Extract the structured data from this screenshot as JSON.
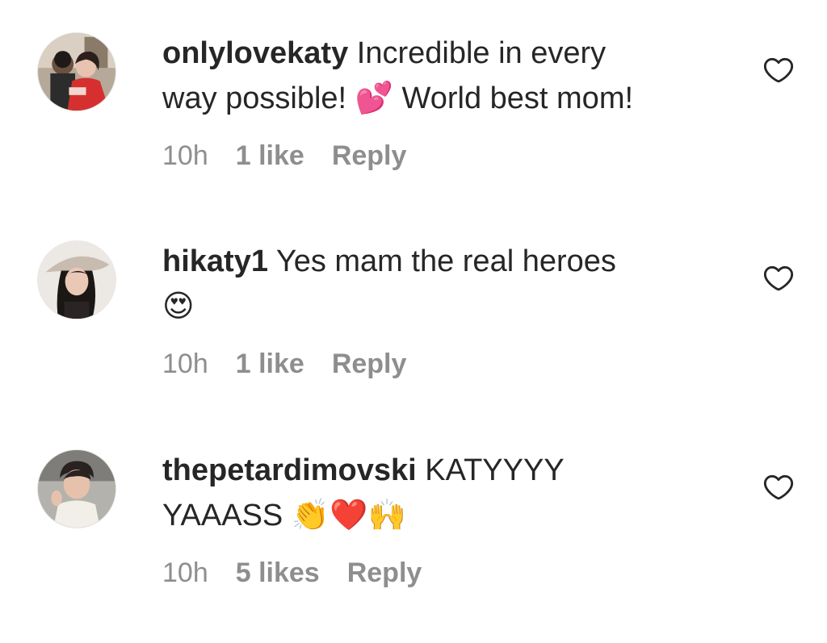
{
  "comments": [
    {
      "username": "onlylovekaty",
      "text": "Incredible in every\nway possible! 💕 World best mom!",
      "time": "10h",
      "likes": "1 like",
      "reply": "Reply",
      "avatar_icon": "user-avatar-photo",
      "like_icon": "heart-outline-icon"
    },
    {
      "username": "hikaty1",
      "text": "Yes mam the real heroes\n😍",
      "time": "10h",
      "likes": "1 like",
      "reply": "Reply",
      "avatar_icon": "user-avatar-photo",
      "like_icon": "heart-outline-icon"
    },
    {
      "username": "thepetardimovski",
      "text": "KATYYYY\nYAAASS 👏❤️🙌",
      "time": "10h",
      "likes": "5 likes",
      "reply": "Reply",
      "avatar_icon": "user-avatar-photo",
      "like_icon": "heart-outline-icon"
    }
  ],
  "colors": {
    "text": "#262626",
    "secondary": "#8e8e8e",
    "background": "#ffffff"
  }
}
